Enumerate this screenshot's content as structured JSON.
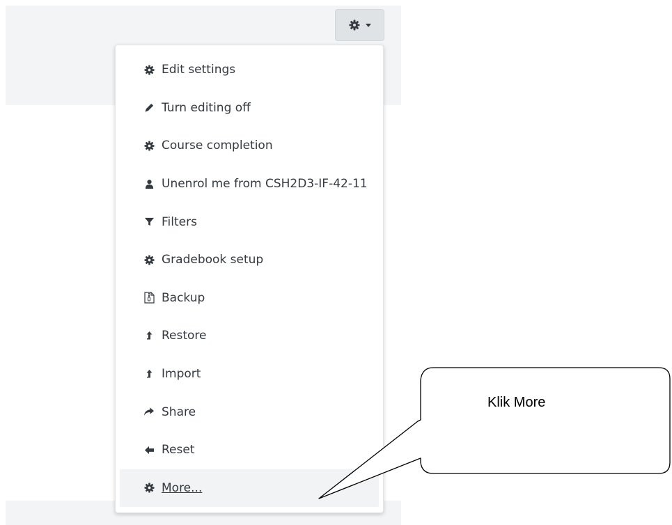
{
  "toolbar": {
    "gear_icon": "gear-icon",
    "caret_icon": "caret-down-icon"
  },
  "menu": {
    "items": [
      {
        "label": "Edit settings",
        "icon": "gear-icon"
      },
      {
        "label": "Turn editing off",
        "icon": "pencil-icon"
      },
      {
        "label": "Course completion",
        "icon": "gear-icon"
      },
      {
        "label": "Unenrol me from CSH2D3-IF-42-11",
        "icon": "user-icon"
      },
      {
        "label": "Filters",
        "icon": "filter-icon"
      },
      {
        "label": "Gradebook setup",
        "icon": "gear-icon"
      },
      {
        "label": "Backup",
        "icon": "file-zip-icon"
      },
      {
        "label": "Restore",
        "icon": "upload-icon"
      },
      {
        "label": "Import",
        "icon": "upload-icon"
      },
      {
        "label": "Share",
        "icon": "share-icon"
      },
      {
        "label": "Reset",
        "icon": "arrow-left-icon"
      },
      {
        "label": "More...",
        "icon": "gear-icon"
      }
    ],
    "active_index": 11
  },
  "callout": {
    "text": "Klik More"
  },
  "colors": {
    "band": "#f2f4f6",
    "menu_text": "#343a40",
    "icon": "#343a40",
    "active_bg": "#f1f3f5"
  }
}
